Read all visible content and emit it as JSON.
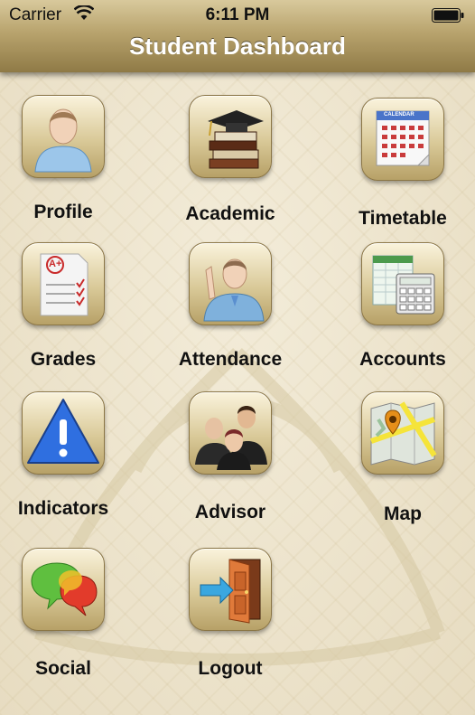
{
  "status_bar": {
    "carrier": "Carrier",
    "time": "6:11 PM",
    "wifi_icon": "wifi-icon",
    "battery_icon": "battery-icon"
  },
  "nav": {
    "title": "Student Dashboard"
  },
  "colors": {
    "nav_bar": "#b8a36d",
    "background": "#ede5cf",
    "icon_tile": "#d9c998",
    "label_text": "#111111",
    "title_text": "#ffffff"
  },
  "tiles": [
    {
      "label": "Profile",
      "icon": "profile-icon"
    },
    {
      "label": "Academic",
      "icon": "academic-icon"
    },
    {
      "label": "Timetable",
      "icon": "calendar-icon"
    },
    {
      "label": "Grades",
      "icon": "grades-icon"
    },
    {
      "label": "Attendance",
      "icon": "attendance-icon"
    },
    {
      "label": "Accounts",
      "icon": "accounts-icon"
    },
    {
      "label": "Indicators",
      "icon": "warning-icon"
    },
    {
      "label": "Advisor",
      "icon": "advisor-icon"
    },
    {
      "label": "Map",
      "icon": "map-icon"
    },
    {
      "label": "Social",
      "icon": "chat-bubbles-icon"
    },
    {
      "label": "Logout",
      "icon": "logout-door-icon"
    }
  ],
  "icon_text": {
    "calendar_header": "CALENDAR",
    "grade_mark": "A+"
  }
}
